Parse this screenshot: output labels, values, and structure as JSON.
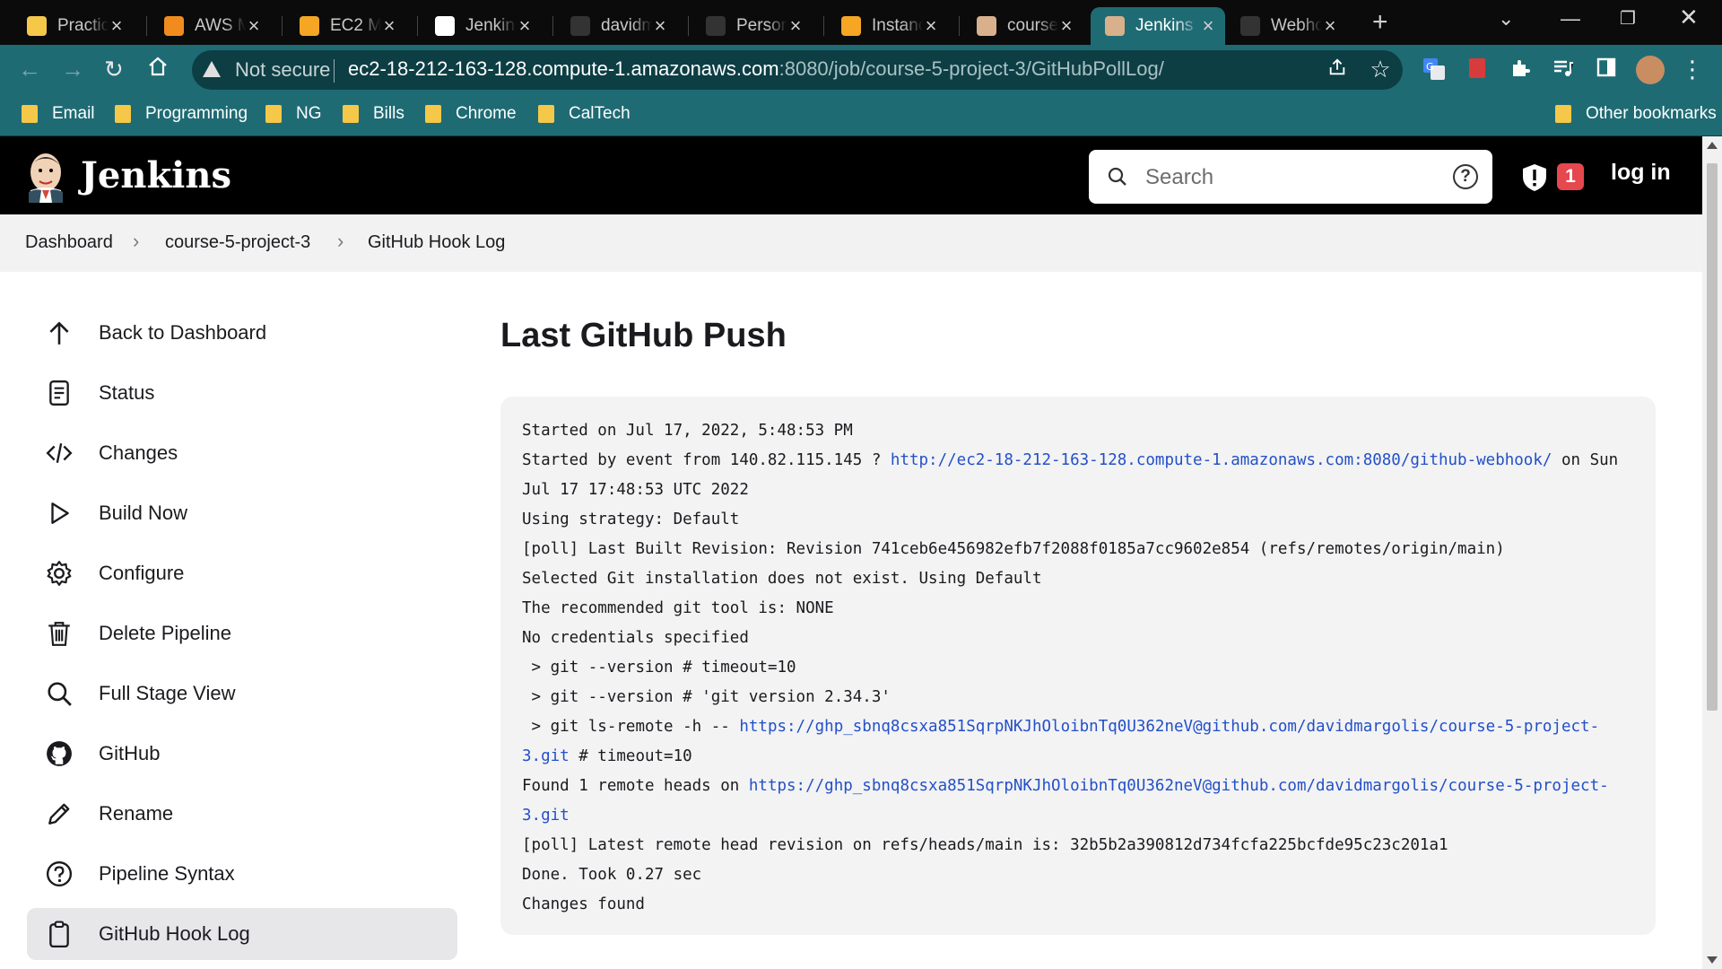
{
  "browser": {
    "tabs": [
      {
        "title": "Practic",
        "icon": "bars-icon",
        "color": "#f5c84a"
      },
      {
        "title": "AWS M",
        "icon": "aws-cube-icon",
        "color": "#f08c1e"
      },
      {
        "title": "EC2 M",
        "icon": "aws-box-icon",
        "color": "#f5a623"
      },
      {
        "title": "Jenkins",
        "icon": "mw-icon",
        "color": "#ffffff"
      },
      {
        "title": "davidm",
        "icon": "github-icon",
        "color": "#333333"
      },
      {
        "title": "Person",
        "icon": "github-icon",
        "color": "#333333"
      },
      {
        "title": "Instanc",
        "icon": "aws-box-icon",
        "color": "#f5a623"
      },
      {
        "title": "course",
        "icon": "jenkins-icon",
        "color": "#d9b08c"
      },
      {
        "title": "Jenkins",
        "icon": "jenkins-icon",
        "color": "#d9b08c"
      },
      {
        "title": "Webho",
        "icon": "github-icon",
        "color": "#333333"
      }
    ],
    "active_tab": 8,
    "address": {
      "security": "Not secure",
      "host": "ec2-18-212-163-128.compute-1.amazonaws.com",
      "rest": ":8080/job/course-5-project-3/GitHubPollLog/"
    },
    "bookmarks": [
      "Email",
      "Programming",
      "NG",
      "Bills",
      "Chrome",
      "CalTech"
    ],
    "other_bookmarks": "Other bookmarks"
  },
  "header": {
    "brand": "Jenkins",
    "search_placeholder": "Search",
    "alert_count": "1",
    "login": "log in"
  },
  "breadcrumbs": [
    "Dashboard",
    "course-5-project-3",
    "GitHub Hook Log"
  ],
  "sidebar": [
    {
      "label": "Back to Dashboard",
      "icon": "arrow-up-icon"
    },
    {
      "label": "Status",
      "icon": "document-icon"
    },
    {
      "label": "Changes",
      "icon": "code-icon"
    },
    {
      "label": "Build Now",
      "icon": "play-icon"
    },
    {
      "label": "Configure",
      "icon": "gear-icon"
    },
    {
      "label": "Delete Pipeline",
      "icon": "trash-icon"
    },
    {
      "label": "Full Stage View",
      "icon": "search-icon"
    },
    {
      "label": "GitHub",
      "icon": "github-icon"
    },
    {
      "label": "Rename",
      "icon": "pencil-icon"
    },
    {
      "label": "Pipeline Syntax",
      "icon": "help-circle-icon"
    },
    {
      "label": "GitHub Hook Log",
      "icon": "clipboard-icon"
    }
  ],
  "active_sidebar": 10,
  "main": {
    "title": "Last GitHub Push",
    "log": [
      {
        "text": "Started on Jul 17, 2022, 5:48:53 PM"
      },
      {
        "pre": "Started by event from 140.82.115.145 ? ",
        "link": "http://ec2-18-212-163-128.compute-1.amazonaws.com:8080/github-webhook/",
        "post": " on Sun Jul 17 17:48:53 UTC 2022"
      },
      {
        "text": "Using strategy: Default"
      },
      {
        "text": "[poll] Last Built Revision: Revision 741ceb6e456982efb7f2088f0185a7cc9602e854 (refs/remotes/origin/main)"
      },
      {
        "text": "Selected Git installation does not exist. Using Default"
      },
      {
        "text": "The recommended git tool is: NONE"
      },
      {
        "text": "No credentials specified"
      },
      {
        "text": " > git --version # timeout=10"
      },
      {
        "text": " > git --version # 'git version 2.34.3'"
      },
      {
        "pre": " > git ls-remote -h -- ",
        "link": "https://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@github.com/davidmargolis/course-5-project-3.git",
        "post": " # timeout=10"
      },
      {
        "pre": "Found 1 remote heads on ",
        "link": "https://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@github.com/davidmargolis/course-5-project-3.git",
        "post": ""
      },
      {
        "text": "[poll] Latest remote head revision on refs/heads/main is: 32b5b2a390812d734fcfa225bcfde95c23c201a1"
      },
      {
        "text": "Done. Took 0.27 sec"
      },
      {
        "text": "Changes found"
      }
    ]
  }
}
